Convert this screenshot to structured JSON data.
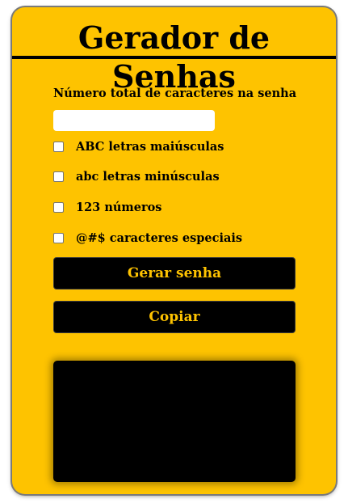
{
  "app": {
    "title": "Gerador de Senhas"
  },
  "length": {
    "label": "Número total de caracteres na senha",
    "value": "",
    "placeholder": ""
  },
  "options": [
    {
      "label": "ABC letras maiúsculas",
      "checked": false
    },
    {
      "label": "abc letras minúsculas",
      "checked": false
    },
    {
      "label": "123 números",
      "checked": false
    },
    {
      "label": "@#$ caracteres especiais",
      "checked": false
    }
  ],
  "buttons": {
    "generate": "Gerar senha",
    "copy": "Copiar"
  },
  "output": {
    "password": ""
  },
  "colors": {
    "accent": "#fec300",
    "dark": "#000000"
  }
}
